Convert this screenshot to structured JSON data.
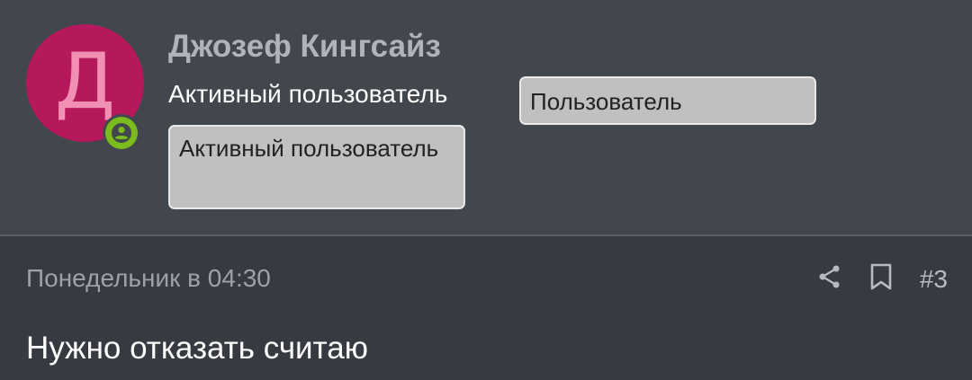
{
  "post": {
    "author": {
      "avatar_letter": "Д",
      "avatar_color": "#b5195c",
      "avatar_letter_color": "#f28fb5",
      "status_icon": "user-online-icon",
      "status_color": "#7cbb1e",
      "name": "Джозеф Кингсайз",
      "title": "Активный пользователь",
      "banners": [
        "Пользователь",
        "Активный пользователь"
      ]
    },
    "timestamp": "Понедельник в 04:30",
    "actions": {
      "share_icon": "share-icon",
      "bookmark_icon": "bookmark-icon",
      "post_number": "#3"
    },
    "message": "Нужно отказать считаю"
  }
}
